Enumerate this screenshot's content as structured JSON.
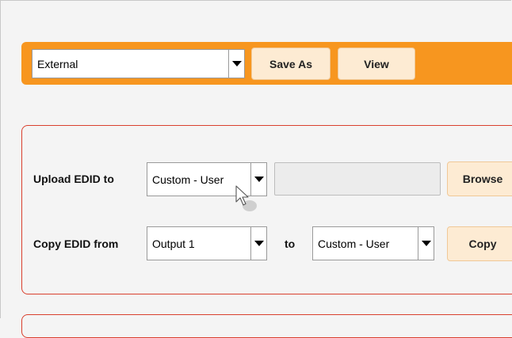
{
  "toolbar": {
    "edid_source_value": "External",
    "save_as_label": "Save As",
    "view_label": "View"
  },
  "upload": {
    "label": "Upload EDID to",
    "target_value": "Custom - User",
    "file_value": "",
    "browse_label": "Browse"
  },
  "copy": {
    "label": "Copy EDID from",
    "source_value": "Output 1",
    "to_label": "to",
    "target_value": "Custom - User",
    "copy_label": "Copy"
  },
  "colors": {
    "toolbar_bg": "#f7961f",
    "panel_border": "#d9402e",
    "button_bg": "#fdebd3"
  },
  "icons": [
    "dropdown-arrow-icon",
    "mouse-pointer-icon"
  ]
}
